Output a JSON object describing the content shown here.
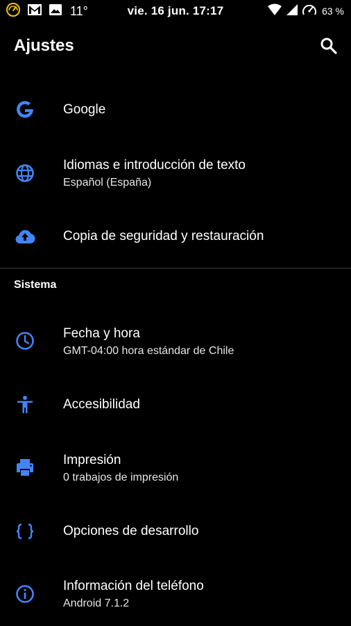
{
  "status_bar": {
    "temperature": "11°",
    "clock": "vie. 16 jun. 17:17",
    "battery": "63 %",
    "left_icons": [
      "speed-meter-icon",
      "gmail-icon",
      "image-icon"
    ],
    "right_icons": [
      "wifi-icon",
      "cell-signal-icon",
      "speedometer-icon"
    ]
  },
  "app_bar": {
    "title": "Ajustes",
    "search_icon": "search-icon"
  },
  "section_header": "Sistema",
  "items": [
    {
      "icon": "google-icon",
      "title": "Google",
      "subtitle": ""
    },
    {
      "icon": "globe-icon",
      "title": "Idiomas e introducción de texto",
      "subtitle": "Español (España)"
    },
    {
      "icon": "cloud-upload-icon",
      "title": "Copia de seguridad y restauración",
      "subtitle": ""
    },
    {
      "icon": "clock-icon",
      "title": "Fecha y hora",
      "subtitle": "GMT-04:00 hora estándar de Chile"
    },
    {
      "icon": "accessibility-icon",
      "title": "Accesibilidad",
      "subtitle": ""
    },
    {
      "icon": "print-icon",
      "title": "Impresión",
      "subtitle": "0 trabajos de impresión"
    },
    {
      "icon": "code-braces-icon",
      "title": "Opciones de desarrollo",
      "subtitle": ""
    },
    {
      "icon": "info-icon",
      "title": "Información del teléfono",
      "subtitle": "Android 7.1.2"
    }
  ],
  "colors": {
    "background": "#000000",
    "accent": "#4285f4",
    "text": "#ffffff",
    "divider": "#3a3a3a"
  }
}
